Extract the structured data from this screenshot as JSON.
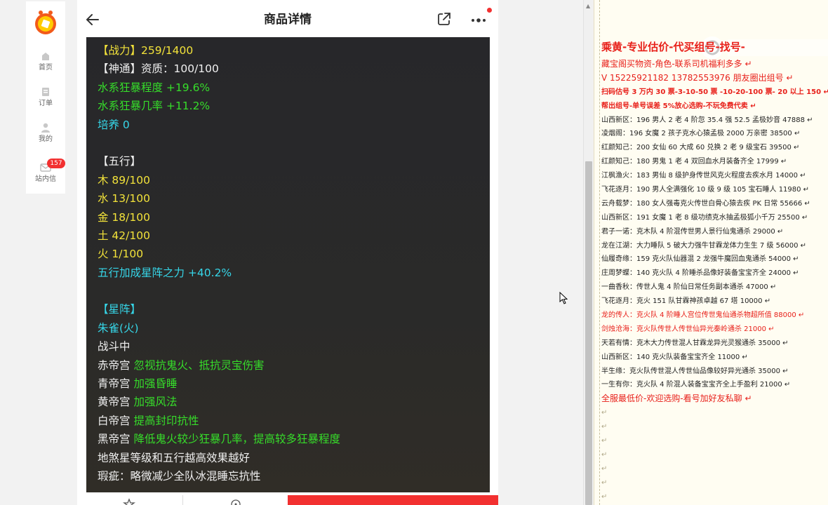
{
  "nav": {
    "home": "首页",
    "orders": "订单",
    "me": "我的",
    "messages": "站内信",
    "message_count": "157"
  },
  "header": {
    "title": "商品详情"
  },
  "detail_lines": [
    {
      "text": "【战力】259/1400",
      "color": "yellow"
    },
    {
      "text": "【神通】资质：100/100",
      "color": "white"
    },
    {
      "text": "水系狂暴程度 +19.6%",
      "color": "green"
    },
    {
      "text": "水系狂暴几率 +11.2%",
      "color": "green"
    },
    {
      "text": "培养 0",
      "color": "cyan"
    },
    {
      "text": "",
      "color": "white"
    },
    {
      "text": "【五行】",
      "color": "white"
    },
    {
      "text": "木 89/100",
      "color": "yellow"
    },
    {
      "text": "水 13/100",
      "color": "yellow"
    },
    {
      "text": "金 18/100",
      "color": "yellow"
    },
    {
      "text": "土 42/100",
      "color": "yellow"
    },
    {
      "text": "火 1/100",
      "color": "yellow"
    },
    {
      "text": "五行加成星阵之力 +40.2%",
      "color": "cyan"
    },
    {
      "text": "",
      "color": "white"
    },
    {
      "text": "【星阵】",
      "color": "cyan"
    },
    {
      "text": "朱雀(火)",
      "color": "cyan"
    },
    {
      "text": "战斗中",
      "color": "white"
    },
    {
      "label": "赤帝宫",
      "effect": "忽视抗鬼火、抵抗灵宝伤害"
    },
    {
      "label": "青帝宫",
      "effect": "加强昏睡"
    },
    {
      "label": "黄帝宫",
      "effect": "加强风法"
    },
    {
      "label": "白帝宫",
      "effect": "提高封印抗性"
    },
    {
      "label": "黑帝宫",
      "effect": "降低鬼火较少狂暴几率，提高较多狂暴程度"
    },
    {
      "text": "地煞星等级和五行越高效果越好",
      "color": "white"
    },
    {
      "text": "瑕疵：略微减少全队冰混睡忘抗性",
      "color": "white"
    }
  ],
  "notes": {
    "title": "乘黄-专业估价-代买组号-找号-",
    "lines": [
      {
        "text": "藏宝阁买物资-角色-联系司机福利多多",
        "style": "r12"
      },
      {
        "text": "V 15225921182   13782553976 朋友圈出组号",
        "style": "r12"
      },
      {
        "text": "扫码估号 3 万内 30 票-3-10-50 票  -10-20-100 票- 20 以上 150",
        "style": "rb"
      },
      {
        "text": "帮出组号-单号误差 5%放心选购-不玩免费代卖",
        "style": "rb"
      },
      {
        "text": "山西新区：196 男人 2 老 4 阶忽 35.4 强 52.5 孟极妙音 47888",
        "style": "plain"
      },
      {
        "text": "凌烟阁：196 女魔 2 孩子克水心猿孟极 2000 万亲密 38500",
        "style": "plain"
      },
      {
        "text": "红颜知己：200 女仙 60 大成 60 兑换 2 老 9 级宝石 39500",
        "style": "plain"
      },
      {
        "text": "红颜知己：180 男鬼 1 老 4 双回血水月装备齐全 17999",
        "style": "plain"
      },
      {
        "text": "江枫渔火：183 男仙 8 级护身传世风克火程度去疾水月 14000",
        "style": "plain"
      },
      {
        "text": "飞花逐月：190 男人全满强化 10 级 9 级 105 宝石睡人 11980",
        "style": "plain"
      },
      {
        "text": "云舟载梦：180 女人强毒克火传世白骨心猿去疾 PK 日常 55666",
        "style": "plain"
      },
      {
        "text": "山西新区：191 女魔 1 老 8 级功绩克水抽孟极狐小千万 25500",
        "style": "plain"
      },
      {
        "text": "君子一诺：克木队 4 阶混传世男人景行仙鬼通杀 29000",
        "style": "plain"
      },
      {
        "text": "龙在江湖：大力睡队 5 破大力强牛甘霖龙体力生生 7 级 56000",
        "style": "plain"
      },
      {
        "text": "仙履奇缘：159 克火队仙器混 2 龙强牛魔回血鬼通杀 54000",
        "style": "plain"
      },
      {
        "text": "庄周梦蝶：140 克火队 4 阶睡杀品像好装备宝宝齐全 24000",
        "style": "plain"
      },
      {
        "text": "一曲香秋：传世人鬼 4 阶仙日常任务副本通杀 47000",
        "style": "plain"
      },
      {
        "text": "飞花逐月：克火 151 队甘霖神孩卓越 67 塔 10000",
        "style": "plain"
      },
      {
        "text": "龙的传人：克火队 4 阶睡人宫位传世鬼仙通杀物超所值 88000",
        "style": "red"
      },
      {
        "text": "剑烛沧海：克火队传世人传世仙异光秦岭通杀 21000",
        "style": "red"
      },
      {
        "text": "天若有情：克木大力传世混人甘霖龙异光灵猴通杀 35000",
        "style": "plain"
      },
      {
        "text": "山西新区：140 克火队装备宝宝齐全 11000",
        "style": "plain"
      },
      {
        "text": "半生缘：克火队传世混人传世仙品像较好异光通杀 35000",
        "style": "plain"
      },
      {
        "text": "一生有你：克火队 4 阶混人装备宝宝齐全上手盈利 21000",
        "style": "plain"
      },
      {
        "text": "全服最低价-欢迎选购-看号加好友私聊",
        "style": "red12"
      }
    ],
    "empty_mark": "↵"
  },
  "colors": {
    "yellow": "#f2e23a",
    "white": "#f0f0f0",
    "green": "#36dd2a",
    "cyan": "#36d6e8",
    "red": "#e8201a",
    "buy_button": "#f23030"
  }
}
